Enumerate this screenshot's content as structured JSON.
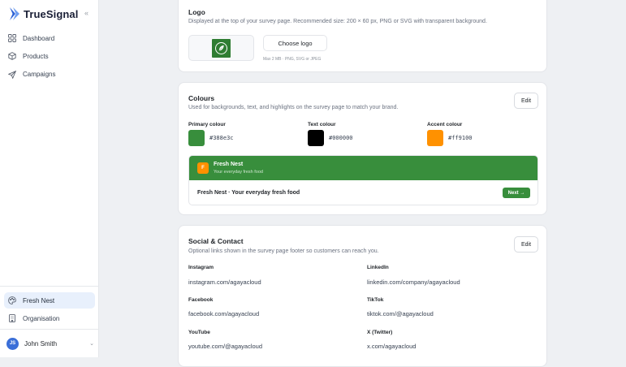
{
  "app": {
    "name": "TrueSignal",
    "collapse_glyph": "«"
  },
  "nav": {
    "top": [
      {
        "label": "Dashboard",
        "icon": "grid-icon"
      },
      {
        "label": "Products",
        "icon": "box-icon"
      },
      {
        "label": "Campaigns",
        "icon": "send-icon"
      }
    ],
    "bottom": [
      {
        "label": "Fresh Nest",
        "icon": "palette-icon",
        "active": true
      },
      {
        "label": "Organisation",
        "icon": "building-icon"
      }
    ]
  },
  "user": {
    "initials": "JS",
    "name": "John Smith",
    "caret": "⌄"
  },
  "logo_section": {
    "title": "Logo",
    "description": "Displayed at the top of your survey page. Recommended size: 200 × 60 px, PNG or SVG with transparent background.",
    "choose_label": "Choose logo",
    "hint": "Max 2 MB · PNG, SVG or JPEG"
  },
  "colours_section": {
    "title": "Colours",
    "description": "Used for backgrounds, text, and highlights on the survey page to match your brand.",
    "edit_label": "Edit",
    "primary": {
      "label": "Primary colour",
      "value": "#388e3c"
    },
    "text": {
      "label": "Text colour",
      "value": "#000000"
    },
    "accent": {
      "label": "Accent colour",
      "value": "#ff9100"
    },
    "preview": {
      "badge": "F",
      "name": "Fresh Nest",
      "tagline": "Your everyday fresh food",
      "body_text": "Fresh Nest · Your everyday fresh food",
      "next_label": "Next →"
    }
  },
  "social_section": {
    "title": "Social & Contact",
    "description": "Optional links shown in the survey page footer so customers can reach you.",
    "edit_label": "Edit",
    "fields": [
      {
        "label": "Instagram",
        "value": "instagram.com/agayacloud"
      },
      {
        "label": "LinkedIn",
        "value": "linkedin.com/company/agayacloud"
      },
      {
        "label": "Facebook",
        "value": "facebook.com/agayacloud"
      },
      {
        "label": "TikTok",
        "value": "tiktok.com/@agayacloud"
      },
      {
        "label": "YouTube",
        "value": "youtube.com/@agayacloud"
      },
      {
        "label": "X (Twitter)",
        "value": "x.com/agayacloud"
      }
    ]
  }
}
